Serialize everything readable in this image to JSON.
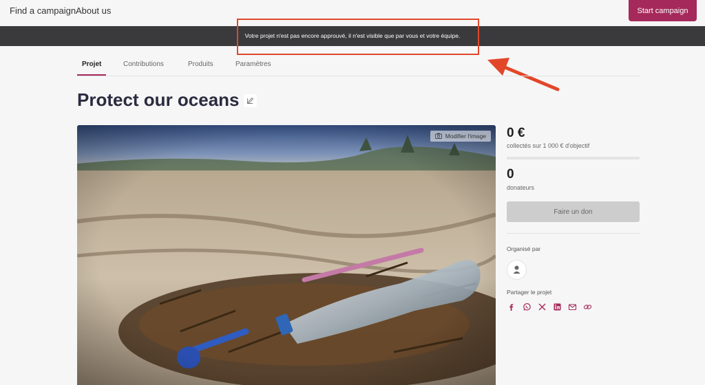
{
  "nav": {
    "links": [
      "Find a campaign",
      "About us"
    ],
    "start_button": "Start campaign"
  },
  "notice": {
    "text": "Votre projet n'est pas encore approuvé, il n'est visible que par vous et votre équipe."
  },
  "tabs": [
    {
      "label": "Projet",
      "active": true
    },
    {
      "label": "Contributions",
      "active": false
    },
    {
      "label": "Produits",
      "active": false
    },
    {
      "label": "Paramètres",
      "active": false
    }
  ],
  "project": {
    "title": "Protect our oceans",
    "modify_image_label": "Modifier l'image"
  },
  "stats": {
    "amount_raised": "0 €",
    "goal_text": "collectés sur 1 000 € d'objectif",
    "progress_fraction": 0,
    "donors_count": "0",
    "donors_label": "donateurs",
    "donate_button": "Faire un don"
  },
  "organizer": {
    "label": "Organisé par"
  },
  "share": {
    "label": "Partager le projet",
    "icons": [
      "facebook-icon",
      "whatsapp-icon",
      "x-icon",
      "linkedin-icon",
      "mail-icon",
      "link-icon"
    ]
  },
  "colors": {
    "accent": "#a5295a",
    "banner": "#3a3a3c",
    "annotation": "#e2472a"
  }
}
